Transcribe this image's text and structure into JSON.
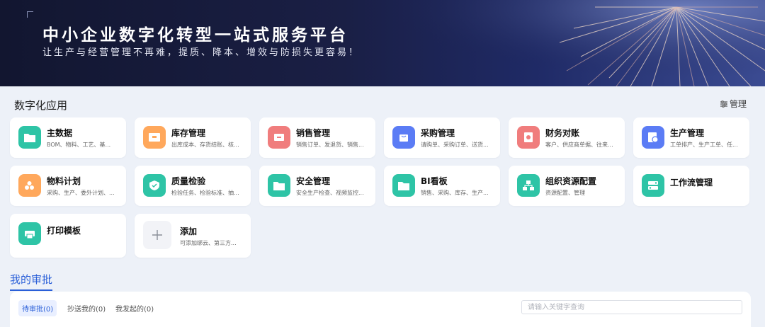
{
  "banner": {
    "title": "中小企业数字化转型一站式服务平台",
    "subtitle": "让生产与经营管理不再难，提质、降本、增效与防损失更容易！"
  },
  "section": {
    "title": "数字化应用",
    "manage_label": "管理"
  },
  "apps": [
    {
      "name": "主数据",
      "desc": "BOM、物料、工艺、基...",
      "icon": "folder-icon",
      "color": "#2ec4a6"
    },
    {
      "name": "库存管理",
      "desc": "出库成本、存货结账、核...",
      "icon": "warehouse-icon",
      "color": "#ffa85c"
    },
    {
      "name": "销售管理",
      "desc": "销售订单、发退货、销售...",
      "icon": "inbox-icon",
      "color": "#f07d7d"
    },
    {
      "name": "采购管理",
      "desc": "请购单、采购订单、送货...",
      "icon": "bag-icon",
      "color": "#5b7cf5"
    },
    {
      "name": "财务对账",
      "desc": "客户、供应商单据、往来...",
      "icon": "finance-icon",
      "color": "#f07d7d"
    },
    {
      "name": "生产管理",
      "desc": "工单排产、生产工单、任...",
      "icon": "production-icon",
      "color": "#5b7cf5"
    },
    {
      "name": "物料计划",
      "desc": "采购、生产、委外计划、...",
      "icon": "material-icon",
      "color": "#ffa85c"
    },
    {
      "name": "质量检验",
      "desc": "检验任务、检验标准、抽...",
      "icon": "shield-icon",
      "color": "#2ec4a6"
    },
    {
      "name": "安全管理",
      "desc": "安全生产检查、视频监控...",
      "icon": "folder-icon",
      "color": "#2ec4a6"
    },
    {
      "name": "BI看板",
      "desc": "销售、采购、库存、生产...",
      "icon": "folder-icon",
      "color": "#2ec4a6"
    },
    {
      "name": "组织资源配置",
      "desc": "资源配置、管理",
      "icon": "org-icon",
      "color": "#2ec4a6"
    },
    {
      "name": "工作流管理",
      "desc": "",
      "icon": "workflow-icon",
      "color": "#2ec4a6"
    },
    {
      "name": "打印模板",
      "desc": "",
      "icon": "printer-icon",
      "color": "#2ec4a6"
    }
  ],
  "add_card": {
    "name": "添加",
    "desc": "可添加绑云、第三方..."
  },
  "approval": {
    "title": "我的审批",
    "tabs": [
      "待审批(0)",
      "抄送我的(0)",
      "我发起的(0)"
    ],
    "search_placeholder": "请输入关键字查询"
  }
}
